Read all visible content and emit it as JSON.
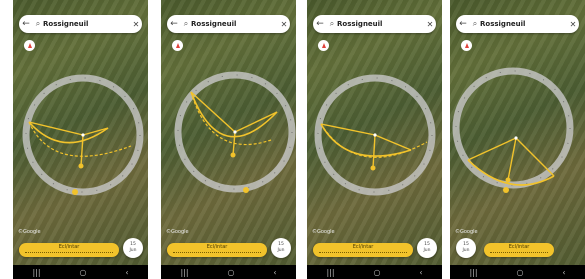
{
  "search": {
    "query": "Rossigneuil"
  },
  "time_slider_label": "Ecl/intar",
  "side_button": {
    "line1": "15",
    "line2": "Jun"
  },
  "copyright": "©Google",
  "nav": {
    "recent": "|||",
    "home": "○",
    "back": "‹"
  },
  "icons": {
    "back": "back-arrow-icon",
    "search": "search-icon",
    "close": "close-icon",
    "compass": "compass-icon"
  },
  "colors": {
    "sun_path": "#f2c32b",
    "ring": "#c8c8c8",
    "slider": "#f2c32b"
  },
  "panels": [
    {
      "label": "Ecl/intar",
      "btn1": "15",
      "btn2": "Jun"
    },
    {
      "label": "Ecl/intar",
      "btn1": "15",
      "btn2": "Jun"
    },
    {
      "label": "Ecl/intar",
      "btn1": "15",
      "btn2": "Jun"
    },
    {
      "label": "Ecl/intar",
      "btn1": "15",
      "btn2": "Jun"
    }
  ]
}
